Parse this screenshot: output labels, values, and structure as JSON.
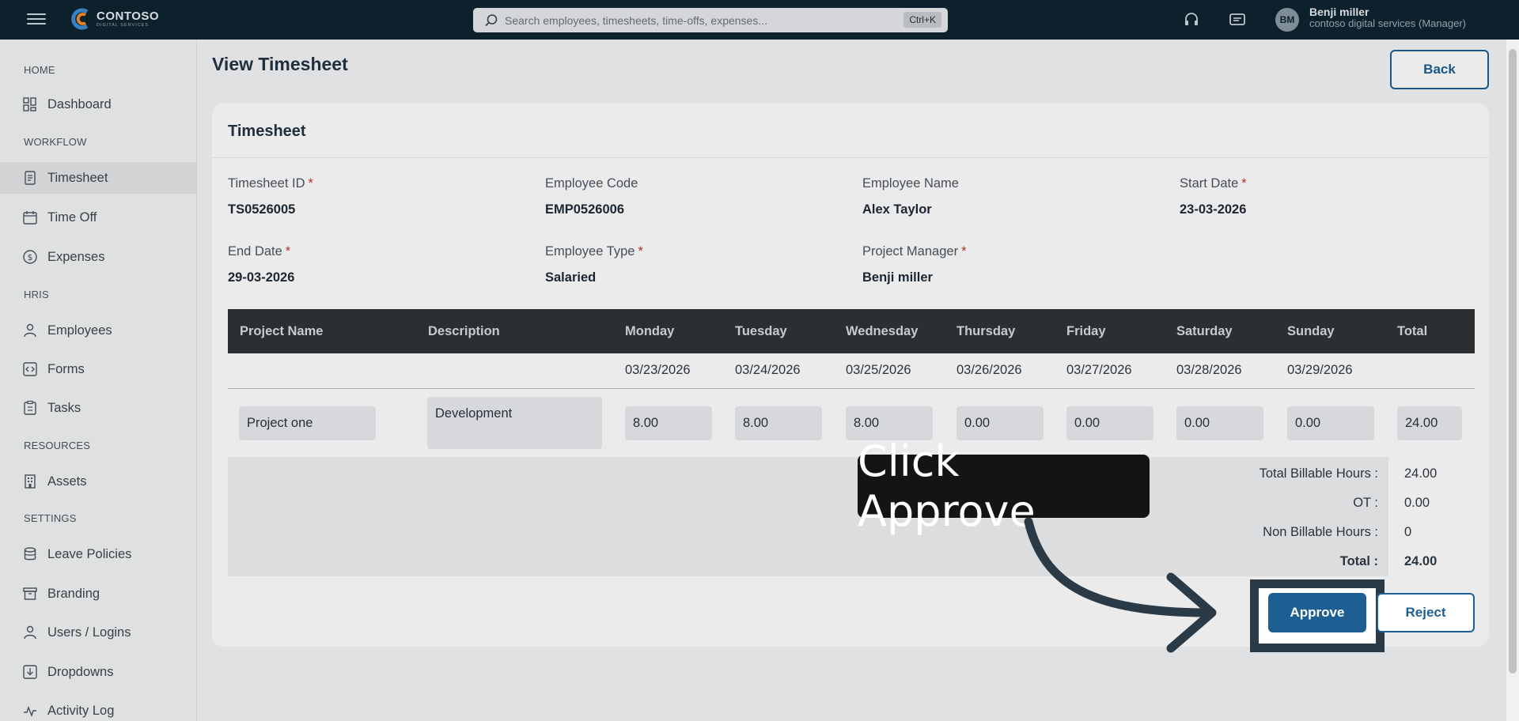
{
  "topbar": {
    "logo_name": "CONTOSO",
    "logo_sub": "DIGITAL SERVICES",
    "search_placeholder": "Search employees, timesheets, time-offs, expenses...",
    "search_shortcut": "Ctrl+K",
    "user_initials": "BM",
    "user_name": "Benji miller",
    "user_role": "contoso digital services (Manager)"
  },
  "sidebar": {
    "sections": [
      {
        "label": "HOME"
      },
      {
        "label": "WORKFLOW"
      },
      {
        "label": "HRIS"
      },
      {
        "label": "RESOURCES"
      },
      {
        "label": "SETTINGS"
      }
    ],
    "items": [
      {
        "label": "Dashboard",
        "icon": "dashboard-icon"
      },
      {
        "label": "Timesheet",
        "icon": "timesheet-icon",
        "active": true
      },
      {
        "label": "Time Off",
        "icon": "calendar-icon"
      },
      {
        "label": "Expenses",
        "icon": "dollar-icon"
      },
      {
        "label": "Employees",
        "icon": "user-icon"
      },
      {
        "label": "Forms",
        "icon": "code-form-icon"
      },
      {
        "label": "Tasks",
        "icon": "clipboard-icon"
      },
      {
        "label": "Assets",
        "icon": "building-icon"
      },
      {
        "label": "Leave Policies",
        "icon": "database-icon"
      },
      {
        "label": "Branding",
        "icon": "archive-icon"
      },
      {
        "label": "Users / Logins",
        "icon": "user-icon"
      },
      {
        "label": "Dropdowns",
        "icon": "download-icon"
      },
      {
        "label": "Activity Log",
        "icon": "activity-icon"
      }
    ]
  },
  "page": {
    "title": "View Timesheet",
    "back_label": "Back"
  },
  "card": {
    "title": "Timesheet",
    "fields": [
      {
        "label": "Timesheet ID",
        "required": "*",
        "value": "TS0526005"
      },
      {
        "label": "Employee Code",
        "required": "",
        "value": "EMP0526006"
      },
      {
        "label": "Employee Name",
        "required": "",
        "value": "Alex Taylor"
      },
      {
        "label": "Start Date",
        "required": "*",
        "value": "23-03-2026"
      },
      {
        "label": "End Date",
        "required": "*",
        "value": "29-03-2026"
      },
      {
        "label": "Employee Type",
        "required": "*",
        "value": "Salaried"
      },
      {
        "label": "Project Manager",
        "required": "*",
        "value": "Benji miller"
      }
    ],
    "table": {
      "headers": [
        "Project Name",
        "Description",
        "Monday",
        "Tuesday",
        "Wednesday",
        "Thursday",
        "Friday",
        "Saturday",
        "Sunday",
        "Total"
      ],
      "dates": [
        "03/23/2026",
        "03/24/2026",
        "03/25/2026",
        "03/26/2026",
        "03/27/2026",
        "03/28/2026",
        "03/29/2026"
      ],
      "row": {
        "project": "Project one",
        "description": "Development",
        "hours": [
          "8.00",
          "8.00",
          "8.00",
          "0.00",
          "0.00",
          "0.00",
          "0.00"
        ],
        "total": "24.00"
      }
    },
    "summary": [
      {
        "label": "Total Billable Hours :",
        "value": "24.00"
      },
      {
        "label": "OT :",
        "value": "0.00"
      },
      {
        "label": "Non Billable Hours :",
        "value": "0"
      },
      {
        "label": "Total :",
        "value": "24.00"
      }
    ],
    "approve_label": "Approve",
    "reject_label": "Reject"
  },
  "tutorial": {
    "callout_text": "Click Approve"
  }
}
